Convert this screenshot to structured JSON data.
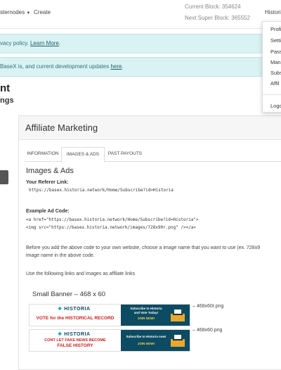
{
  "nav": {
    "masternodes": "sternodes",
    "create": "Create",
    "current_block": "Current Block: 354624",
    "next_super_block": "Next Super Block: 365552",
    "user": "Historia"
  },
  "alerts": [
    {
      "text": "vacy policy. ",
      "link": "Learn More",
      "tail": "."
    },
    {
      "text": "BaseX is, and current development updates ",
      "link": "here",
      "tail": "."
    }
  ],
  "dropdown": [
    "Profi",
    "Setti",
    "Pass",
    "Mana",
    "Subs",
    "Affil",
    "Logo"
  ],
  "page": {
    "title": "nt",
    "subtitle": "ngs"
  },
  "panel": {
    "title": "Affiliate Marketing",
    "tabs": [
      "INFORMATION",
      "IMAGES & ADS",
      "PAST PAYOUTS"
    ],
    "section_title": "Images & Ads",
    "referer_label": "Your Referer Link:",
    "referer_link": "https://basex.historia.network/Home/Subscribe?id=Historia",
    "ad_code_label": "Example Ad Code:",
    "ad_code_line1": "<a href=\"https://basex.historia.network/Home/Subscribe?id=Historia\">",
    "ad_code_line2": "<img src=\"https://basex.historia.network/images/728x90r.png\" /></a>",
    "para1_line1": "Before you add the above code to your own website, choose a image name that you want to use (ex. 728x9",
    "para1_line2": "image name in the above code.",
    "para2": "Use the following links and images as affilate links",
    "banner_section": "Small Banner – 468 x 60",
    "banners": [
      {
        "logo": "HISTORIA",
        "tagline": "VOTE for the HISTORICAL RECORD",
        "right1": "Subscribe to Historia",
        "right2": "and Vote Today!",
        "right3": "JOIN NOW!",
        "file": "– 468x60r.png"
      },
      {
        "logo": "HISTORIA",
        "tagline": "CONT LET FAKE NEWS BECOME",
        "tagline2": "FALSE HISTORY",
        "right1": "Subscribe to Historia now!",
        "right3": "JOIN NOW!",
        "file": "– 468x60.png"
      }
    ]
  },
  "colors": {
    "alert_bg": "#d9f2f4",
    "banner_dark": "#0d4b62",
    "banner_red": "#c8201f",
    "accent": "#1fa9c6"
  }
}
